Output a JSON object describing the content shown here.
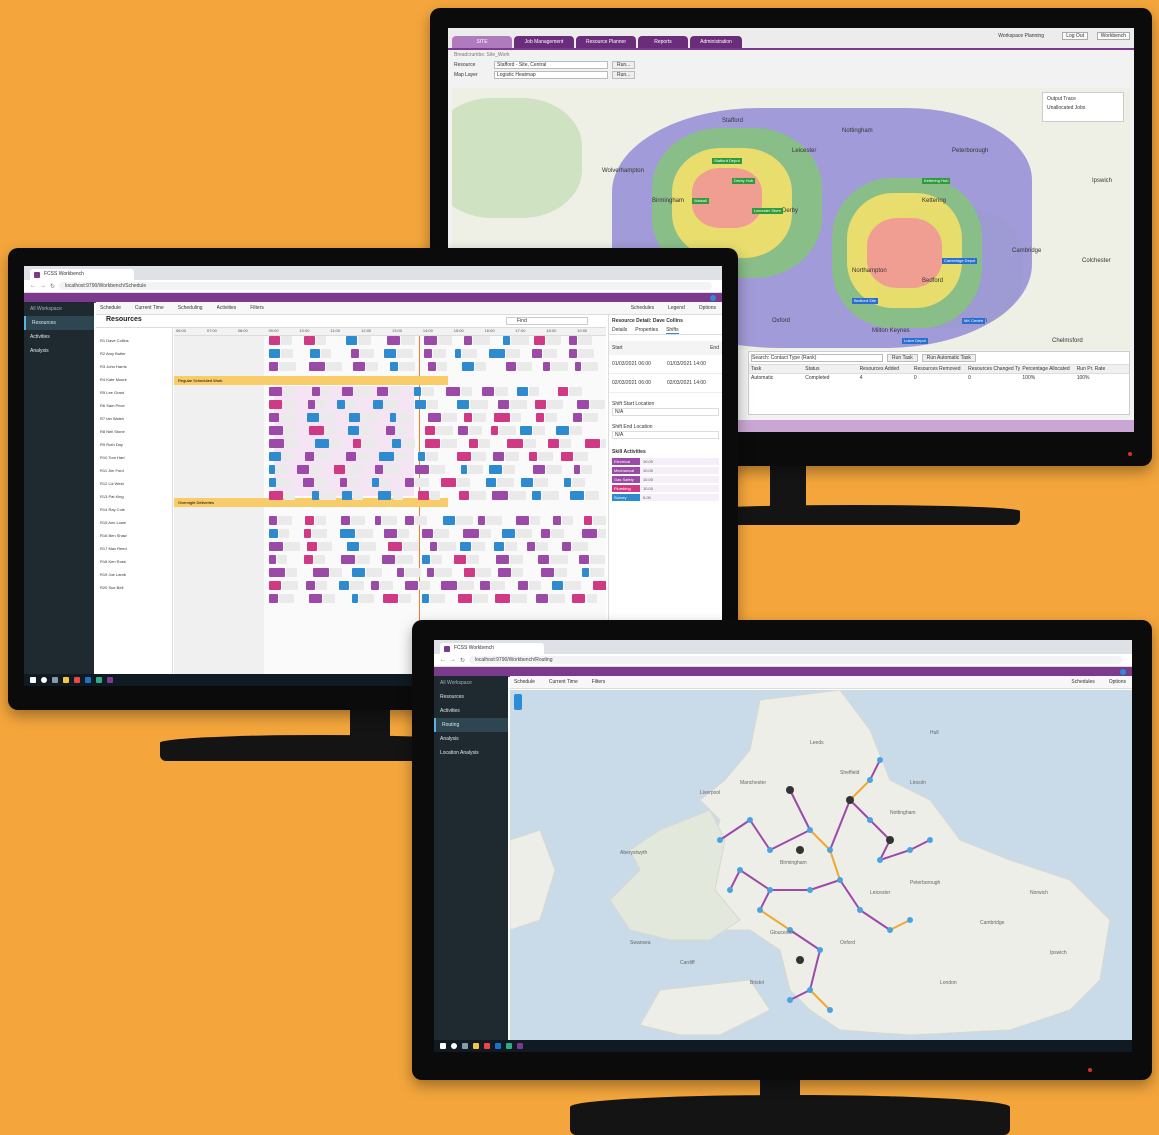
{
  "colors": {
    "background": "#f4a63c",
    "brand_purple": "#7b3a8c",
    "accent_blue": "#2a8dd8",
    "gantt_yellow": "#f9cc6a",
    "gantt_purple": "#9b4aa7",
    "gantt_blue": "#2e8bd0",
    "gantt_magenta": "#d03a84",
    "node_blue": "#4aa3df",
    "node_dark": "#333333",
    "route_purple": "#9b4aa7",
    "route_orange": "#f0a830"
  },
  "back_monitor": {
    "tabs": [
      "SITE",
      "Job Management",
      "Resource Planner",
      "Reports",
      "Administration"
    ],
    "header_right": "Workspace Planning",
    "header_buttons": [
      "Log Out",
      "Workbench"
    ],
    "breadcrumb": "Breadcrumbs: Site_Work",
    "filter_rows": [
      {
        "label": "Resource",
        "value": "Stafford - Site, Central",
        "button": "Run..."
      },
      {
        "label": "Map Layer",
        "value": "Logistic Heatmap",
        "button": "Run..."
      }
    ],
    "legend": {
      "items": [
        "Output Trace",
        "Unallocated Jobs"
      ]
    },
    "map_labels": [
      "Stafford",
      "Derby",
      "Leicester",
      "Birmingham",
      "Coventry",
      "Northampton",
      "Bedford",
      "Cambridge",
      "Oxford",
      "Kettering",
      "Wolverhampton",
      "Nottingham",
      "Chelmsford",
      "Colchester",
      "Peterborough",
      "Hereford",
      "Ipswich",
      "Milton Keynes",
      "Worcester",
      "Luton"
    ],
    "map_pins": [
      {
        "text": "Stafford Depot",
        "color": "green"
      },
      {
        "text": "Derby Hub",
        "color": "green"
      },
      {
        "text": "Walsall",
        "color": "green"
      },
      {
        "text": "Leicester Store",
        "color": "green"
      },
      {
        "text": "Coventry Depot",
        "color": "green"
      },
      {
        "text": "Kettering Hub",
        "color": "green"
      },
      {
        "text": "Cambridge Depot",
        "color": "blue"
      },
      {
        "text": "Bedford Site",
        "color": "blue"
      },
      {
        "text": "MK Centre",
        "color": "blue"
      },
      {
        "text": "Luton Depot",
        "color": "blue"
      }
    ],
    "table_toolbar": {
      "search_value": "Search: Contact Type (Rank)",
      "buttons": [
        "Run Task",
        "Run Automatic Task"
      ]
    },
    "table_headers": [
      "Task",
      "Status",
      "Resources Added",
      "Resources Removed",
      "Resources Changed Type",
      "Percentage Allocated",
      "Run Pr. Rate"
    ],
    "table_rows": [
      [
        "Automatic",
        "Completed",
        "4",
        "0",
        "0",
        "100%",
        "100%"
      ]
    ]
  },
  "left_monitor": {
    "browser_tab": "FCSS Workbench",
    "url": "localhost:9790/Workbench/Schedule",
    "nav_header": "All Workspace",
    "nav_items": [
      {
        "label": "Resources",
        "active": true
      },
      {
        "label": "Activities",
        "active": false
      },
      {
        "label": "Analysis",
        "active": false
      }
    ],
    "toolbar_items": [
      "Schedule",
      "Current Time",
      "Scheduling",
      "Activities",
      "Filters"
    ],
    "toolbar_right": [
      "Schedules",
      "Legend",
      "Options"
    ],
    "title": "Resources",
    "search_placeholder": "Find",
    "timeline_hours": [
      "06:00",
      "07:00",
      "08:00",
      "09:00",
      "10:00",
      "11:00",
      "12:00",
      "13:00",
      "14:00",
      "15:00",
      "16:00",
      "17:00",
      "18:00",
      "19:00"
    ],
    "resources": [
      "R1 Dave Collins",
      "R2 Amy Butler",
      "R3 John Harris",
      "R4 Kate Moore",
      "R5 Lee Grant",
      "R6 Sam Price",
      "R7 Ian Walsh",
      "R8 Neil Stone",
      "R9 Ruth Day",
      "R10 Tom Hart",
      "R11 Jim Ford",
      "R12 Liz West",
      "R13 Pat King",
      "R14 Ray Cole",
      "R15 Ann Lowe",
      "R16 Ben Shaw",
      "R17 Max Reed",
      "R18 Ken Rose",
      "R19 Joe Lamb",
      "R20 Sue Bell"
    ],
    "group_bars": [
      "Regular Scheduled Work",
      "Overnight Deliveries"
    ],
    "detail_panel": {
      "title": "Resource Detail: Dave Collins",
      "tabs": [
        "Details",
        "Properties",
        "Shifts"
      ],
      "col_headers": [
        "Start",
        "End"
      ],
      "rows": [
        [
          "01/03/2021 06:00",
          "01/03/2021 14:00"
        ],
        [
          "02/03/2021 06:00",
          "02/03/2021 14:00"
        ]
      ],
      "fields": [
        {
          "label": "Shift Start Location",
          "value": "N/A"
        },
        {
          "label": "Shift End Location",
          "value": "N/A"
        }
      ],
      "skills_title": "Skill Activities",
      "skills": [
        {
          "name": "Electrical",
          "value": "10.00",
          "color": "#9b4aa7"
        },
        {
          "name": "Mechanical",
          "value": "10.00",
          "color": "#9b4aa7"
        },
        {
          "name": "Gas Safety",
          "value": "10.00",
          "color": "#9b4aa7"
        },
        {
          "name": "Plumbing",
          "value": "10.00",
          "color": "#d03a84"
        },
        {
          "name": "Survey",
          "value": "5.00",
          "color": "#2e8bd0"
        }
      ]
    }
  },
  "right_monitor": {
    "browser_tab": "FCSS Workbench",
    "url": "localhost:9790/Workbench/Routing",
    "nav_header": "All Workspace",
    "nav_items": [
      {
        "label": "Resources",
        "active": false
      },
      {
        "label": "Activities",
        "active": false
      },
      {
        "label": "Routing",
        "active": true
      },
      {
        "label": "Analysis",
        "active": false
      },
      {
        "label": "Location Analysis",
        "active": false
      }
    ],
    "toolbar_items": [
      "Schedule",
      "Current Time",
      "Filters"
    ],
    "toolbar_right": [
      "Schedules",
      "Options"
    ],
    "map_labels": [
      "Leeds",
      "Manchester",
      "Sheffield",
      "Nottingham",
      "Birmingham",
      "Leicester",
      "Norwich",
      "Cambridge",
      "Cardiff",
      "Bristol",
      "London",
      "Oxford",
      "Liverpool",
      "Hull",
      "Lincoln",
      "Ipswich",
      "Swansea",
      "Peterborough",
      "Gloucester",
      "Aberystwyth"
    ]
  }
}
